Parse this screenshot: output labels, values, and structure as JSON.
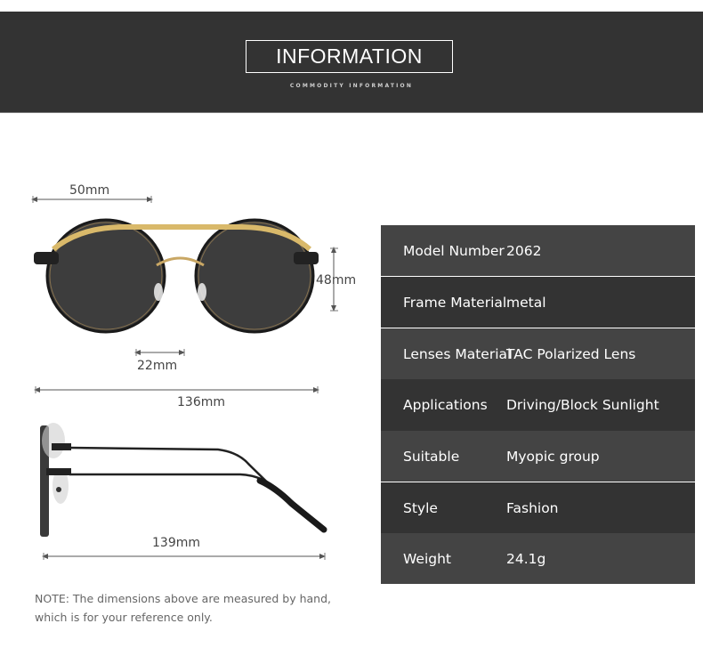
{
  "header": {
    "title": "INFORMATION",
    "subtitle": "COMMODITY INFORMATION"
  },
  "front_view": {
    "lens_width_label": "50mm",
    "lens_height_label": "48mm",
    "bridge_label": "22mm",
    "frame_width_label": "136mm"
  },
  "side_view": {
    "temple_length_label": "139mm"
  },
  "specs": [
    {
      "key": "Model Number",
      "value": "2062"
    },
    {
      "key": "Frame Material",
      "value": "metal"
    },
    {
      "key": "Lenses Material",
      "value": "TAC Polarized Lens"
    },
    {
      "key": "Applications",
      "value": "Driving/Block Sunlight"
    },
    {
      "key": "Suitable",
      "value": "Myopic group"
    },
    {
      "key": "Style",
      "value": "Fashion"
    },
    {
      "key": "Weight",
      "value": "24.1g"
    }
  ],
  "note": {
    "line1": "NOTE: The dimensions above are measured by hand,",
    "line2": "which is for your reference only."
  },
  "colors": {
    "header_bg": "#333333",
    "row_light": "#444444",
    "row_dark": "#333333",
    "frame_gold": "#d9b96a",
    "lens_gray": "#3f3f3f"
  }
}
